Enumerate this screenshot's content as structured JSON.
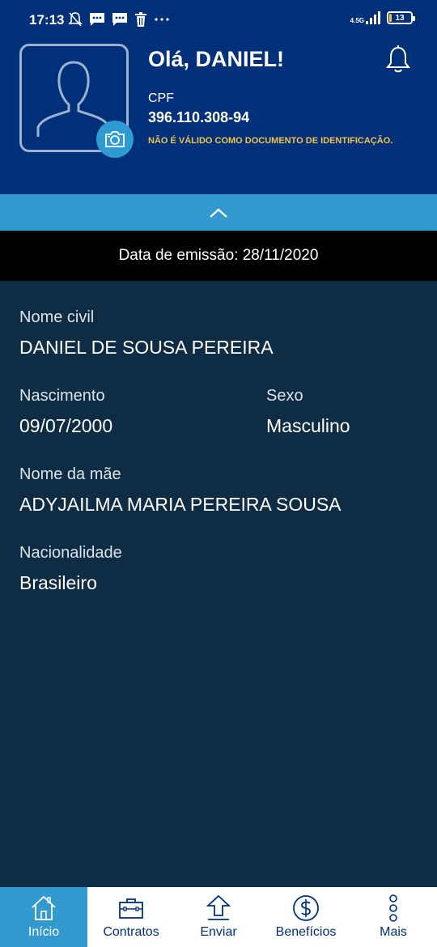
{
  "status_bar": {
    "time": "17:13",
    "network": "4.5G",
    "battery": "13",
    "battery_level": 0.13,
    "icons": [
      "mute-bell-icon",
      "message-icon",
      "message-icon",
      "trash-icon",
      "more-dots-icon",
      "signal-icon",
      "battery-icon"
    ]
  },
  "header": {
    "greeting": "Olá, DANIEL!",
    "cpf_label": "CPF",
    "cpf_value": "396.110.308-94",
    "cpf_warning": "NÃO É VÁLIDO COMO DOCUMENTO DE IDENTIFICAÇÃO."
  },
  "emission": {
    "text": "Data de emissão: 28/11/2020"
  },
  "details": {
    "nome_civil_label": "Nome civil",
    "nome_civil_value": "DANIEL DE SOUSA PEREIRA",
    "nascimento_label": "Nascimento",
    "nascimento_value": "09/07/2000",
    "sexo_label": "Sexo",
    "sexo_value": "Masculino",
    "nome_mae_label": "Nome da mãe",
    "nome_mae_value": "ADYJAILMA MARIA PEREIRA SOUSA",
    "nacionalidade_label": "Nacionalidade",
    "nacionalidade_value": "Brasileiro"
  },
  "nav": {
    "items": [
      {
        "label": "Início",
        "icon": "home-icon",
        "active": true
      },
      {
        "label": "Contratos",
        "icon": "briefcase-icon",
        "active": false
      },
      {
        "label": "Enviar",
        "icon": "upload-icon",
        "active": false
      },
      {
        "label": "Benefícios",
        "icon": "dollar-icon",
        "active": false
      },
      {
        "label": "Mais",
        "icon": "more-vertical-icon",
        "active": false
      }
    ]
  },
  "colors": {
    "header_bg": "#003079",
    "accent": "#339acf",
    "details_bg": "#0e2d45",
    "warning": "#f3c34b"
  }
}
